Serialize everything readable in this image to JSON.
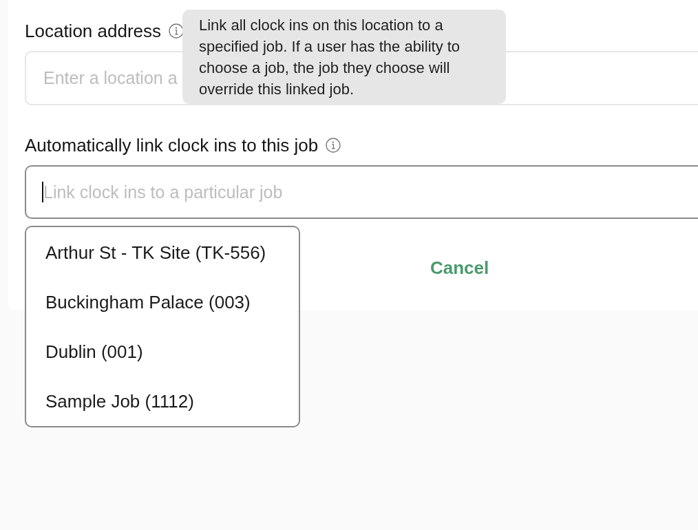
{
  "form": {
    "fields": [
      {
        "label": "Location address",
        "placeholder": "Enter a location a",
        "focused": false
      },
      {
        "label": "Automatically link clock ins to this job",
        "placeholder": "Link clock ins to a particular job",
        "focused": true
      }
    ],
    "actions": [
      {
        "label": "Cancel"
      }
    ]
  },
  "tooltip": {
    "text": "Link all clock ins on this location to a specified job. If a user has the ability to choose a job, the job they choose will override this linked job."
  },
  "dropdown": {
    "options": [
      {
        "label": "Arthur St - TK Site (TK-556)",
        "selected": false
      },
      {
        "label": "Buckingham Palace (003)",
        "selected": false
      },
      {
        "label": "Dublin (001)",
        "selected": false
      },
      {
        "label": "Sample Job (1112)",
        "selected": false
      }
    ]
  }
}
